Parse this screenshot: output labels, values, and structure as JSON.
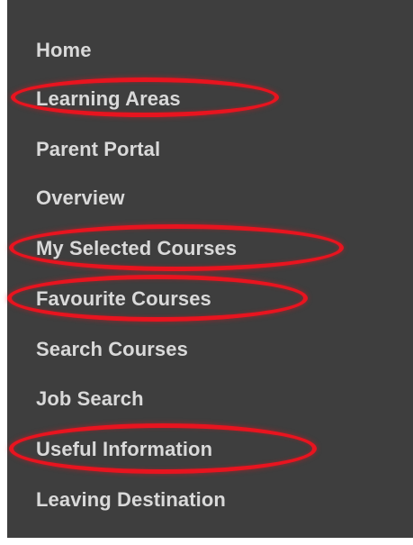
{
  "nav": {
    "items": [
      {
        "label": "Home",
        "highlighted": false
      },
      {
        "label": "Learning Areas",
        "highlighted": true
      },
      {
        "label": "Parent Portal",
        "highlighted": false
      },
      {
        "label": "Overview",
        "highlighted": false
      },
      {
        "label": "My Selected Courses",
        "highlighted": true
      },
      {
        "label": "Favourite Courses",
        "highlighted": true
      },
      {
        "label": "Search Courses",
        "highlighted": false
      },
      {
        "label": "Job Search",
        "highlighted": false
      },
      {
        "label": "Useful Information",
        "highlighted": true
      },
      {
        "label": "Leaving Destination",
        "highlighted": false
      }
    ]
  },
  "colors": {
    "panel_background": "#3e3e3e",
    "text": "#d9d9d9",
    "annotation": "#e8141f"
  }
}
